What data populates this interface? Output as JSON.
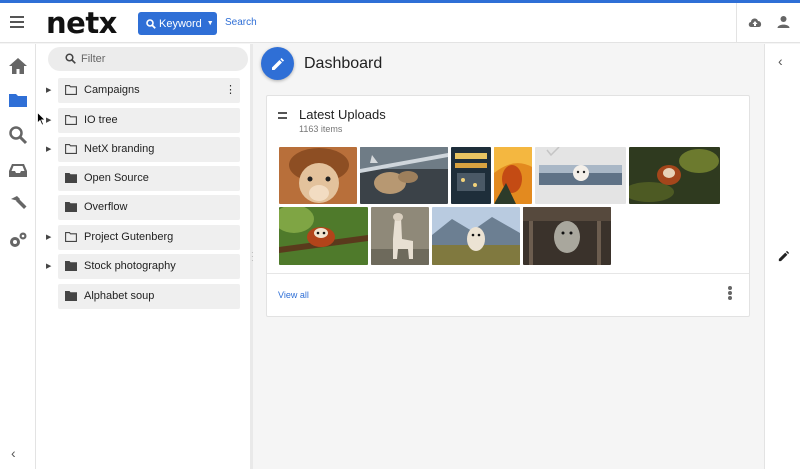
{
  "app": {
    "logo": "netx",
    "keyword_label": "Keyword",
    "search_link": "Search"
  },
  "colors": {
    "brand_blue": "#2f6fd6",
    "rail_icon": "#666666",
    "active_icon": "#2f6fd6"
  },
  "left_rail": {
    "items": [
      {
        "name": "home-icon",
        "active": false
      },
      {
        "name": "folder-icon",
        "active": true
      },
      {
        "name": "search-icon",
        "active": false
      },
      {
        "name": "inbox-icon",
        "active": false
      },
      {
        "name": "hammer-icon",
        "active": false
      },
      {
        "name": "gears-icon",
        "active": false
      }
    ],
    "collapse": "‹"
  },
  "tree": {
    "filter_placeholder": "Filter",
    "folders": [
      {
        "label": "Campaigns",
        "expandable": true,
        "open_folder_outline": true,
        "more": "⋮"
      },
      {
        "label": "IO tree",
        "expandable": true,
        "open_folder_outline": true
      },
      {
        "label": "NetX branding",
        "expandable": true,
        "open_folder_outline": true
      },
      {
        "label": "Open Source",
        "expandable": false,
        "open_folder_outline": false
      },
      {
        "label": "Overflow",
        "expandable": false,
        "open_folder_outline": false
      },
      {
        "label": "Project Gutenberg",
        "expandable": true,
        "open_folder_outline": true
      },
      {
        "label": "Stock photography",
        "expandable": true,
        "open_folder_outline": false
      },
      {
        "label": "Alphabet soup",
        "expandable": false,
        "open_folder_outline": false
      }
    ]
  },
  "main": {
    "title": "Dashboard",
    "card": {
      "title": "Latest Uploads",
      "subtitle": "1163 items",
      "view_all": "View all",
      "thumbnails": [
        {
          "subject": "alpaca close-up"
        },
        {
          "subject": "dog in car window"
        },
        {
          "subject": "night street market"
        },
        {
          "subject": "orange bird painting"
        },
        {
          "subject": "alpaca by lake (selected)"
        },
        {
          "subject": "red panda in forest"
        },
        {
          "subject": "red panda on branch"
        },
        {
          "subject": "llama standing"
        },
        {
          "subject": "alpaca and mountains"
        },
        {
          "subject": "alpaca behind fence"
        }
      ]
    }
  },
  "right_rail": {
    "collapse": "‹"
  }
}
